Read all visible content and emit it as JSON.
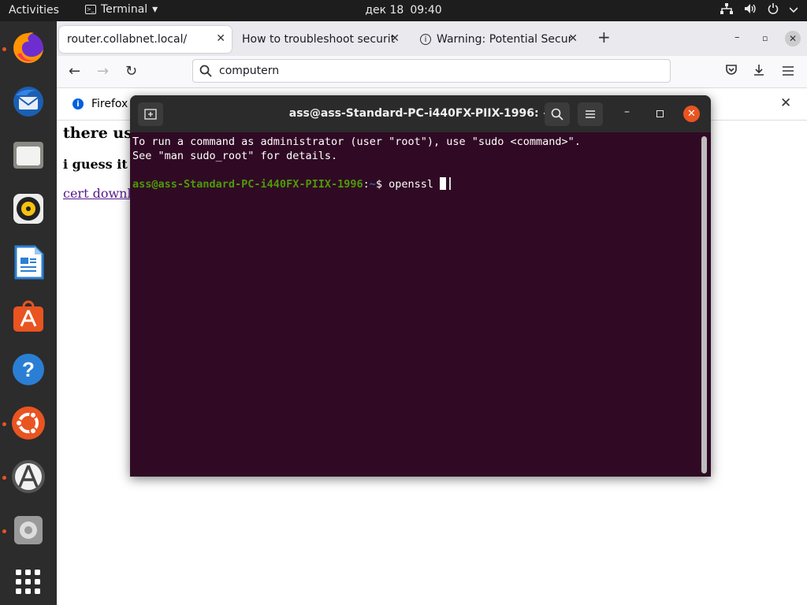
{
  "topbar": {
    "activities": "Activities",
    "app_name": "Terminal",
    "app_menu_arrow": "▾",
    "date": "дек 18",
    "time": "09:40"
  },
  "dock": {
    "items": [
      {
        "name": "firefox-icon"
      },
      {
        "name": "thunderbird-icon"
      },
      {
        "name": "files-icon"
      },
      {
        "name": "rhythmbox-icon"
      },
      {
        "name": "libreoffice-writer-icon"
      },
      {
        "name": "ubuntu-software-icon"
      },
      {
        "name": "help-icon"
      },
      {
        "name": "ubuntu-icon"
      },
      {
        "name": "software-updater-icon"
      },
      {
        "name": "settings-icon"
      },
      {
        "name": "show-applications-icon"
      }
    ]
  },
  "firefox": {
    "tabs": [
      {
        "label": "router.collabnet.local/",
        "active": true
      },
      {
        "label": "How to troubleshoot securit",
        "active": false
      },
      {
        "label": "Warning: Potential Secur",
        "active": false
      }
    ],
    "new_tab": "+",
    "url": "computern",
    "notification": "Firefox",
    "page": {
      "heading": "there us",
      "subheading": "i guess it",
      "link": "cert downl"
    }
  },
  "terminal": {
    "title": "ass@ass-Standard-PC-i440FX-PIIX-1996: ~",
    "lines": [
      "To run a command as administrator (user \"root\"), use \"sudo <command>\".",
      "See \"man sudo_root\" for details."
    ],
    "prompt_user": "ass@ass-Standard-PC-i440FX-PIIX-1996",
    "prompt_sep": ":",
    "prompt_path": "~",
    "prompt_symbol": "$ ",
    "command": "openssl "
  }
}
